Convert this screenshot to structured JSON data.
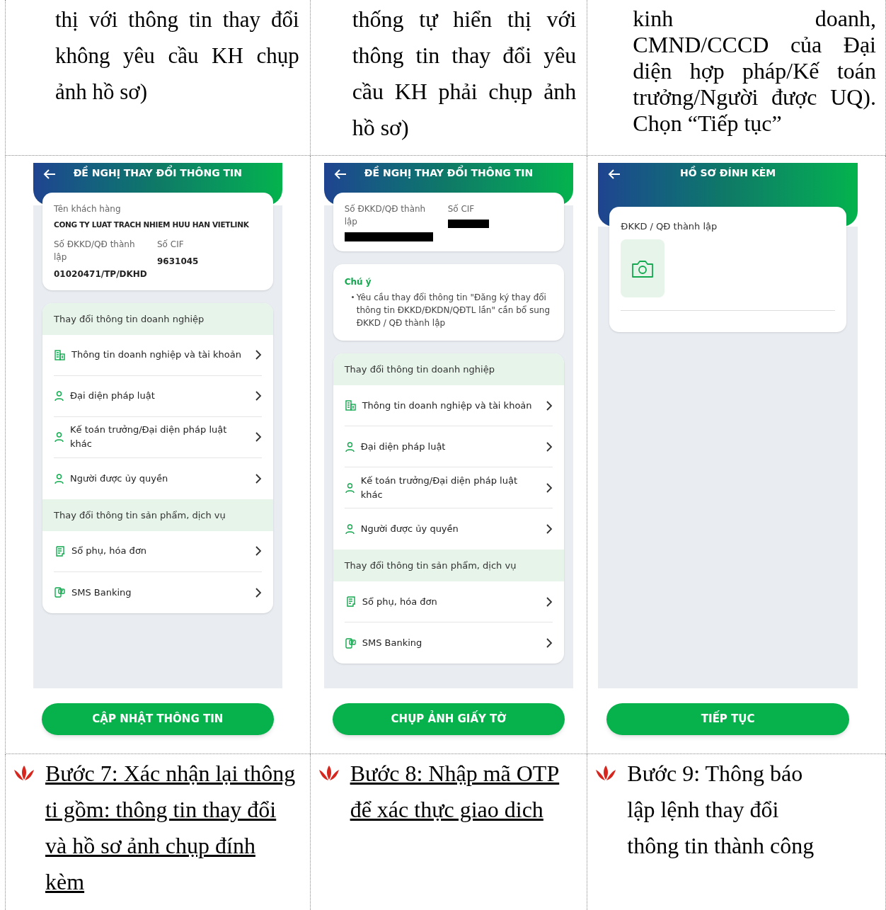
{
  "intro_row": [
    {
      "text": "thị với thông tin thay đổi không yêu cầu KH chụp ảnh hồ sơ)"
    },
    {
      "text": "thống tự hiển thị với thông tin thay đổi yêu cầu KH phải chụp ảnh hồ sơ)"
    },
    {
      "text": "kinh doanh, CMND/CCCD của Đại diện hợp pháp/Kế toán trưởng/Người được UQ). Chọn “Tiếp tục”"
    }
  ],
  "screens": [
    {
      "kind": "form",
      "title": "ĐỀ NGHỊ THAY ĐỔI THÔNG TIN",
      "info": {
        "customer_label": "Tên khách hàng",
        "customer_name": "CONG TY LUAT TRACH NHIEM HUU HAN VIETLINK",
        "fields": [
          {
            "label": "Số ĐKKD/QĐ thành lập",
            "value": "01020471/TP/DKHD",
            "redacted": false
          },
          {
            "label": "Số CIF",
            "value": "9631045",
            "redacted": false
          }
        ]
      },
      "sections": [
        {
          "title": "Thay đổi thông tin doanh nghiệp",
          "items": [
            {
              "kind": "building",
              "label": "Thông tin doanh nghiệp và tài khoản"
            },
            {
              "kind": "person",
              "label": "Đại diện pháp luật"
            },
            {
              "kind": "person",
              "label": "Kế toán trưởng/Đại diện pháp luật khác"
            },
            {
              "kind": "person",
              "label": "Người được ủy quyền"
            }
          ]
        },
        {
          "title": "Thay đổi thông tin sản phẩm, dịch vụ",
          "items": [
            {
              "kind": "receipt",
              "label": "Sổ phụ, hóa đơn"
            },
            {
              "kind": "phone",
              "label": "SMS Banking"
            }
          ]
        }
      ],
      "button": "CẬP NHẬT THÔNG TIN"
    },
    {
      "kind": "form",
      "title": "ĐỀ NGHỊ THAY ĐỔI THÔNG TIN",
      "info": {
        "fields": [
          {
            "label": "Số ĐKKD/QĐ thành lập",
            "redacted": true
          },
          {
            "label": "Số CIF",
            "redacted": true
          }
        ]
      },
      "notice": {
        "title": "Chú ý",
        "bullet": "Yêu cầu thay đổi thông tin \"Đăng ký thay đổi thông tin ĐKKD/ĐKDN/QĐTL lần\" cần bổ sung ĐKKD / QĐ thành lập"
      },
      "sections": [
        {
          "title": "Thay đổi thông tin doanh nghiệp",
          "items": [
            {
              "kind": "building",
              "label": "Thông tin doanh nghiệp và tài khoản"
            },
            {
              "kind": "person",
              "label": "Đại diện pháp luật"
            },
            {
              "kind": "person",
              "label": "Kế toán trưởng/Đại diện pháp luật khác"
            },
            {
              "kind": "person",
              "label": "Người được ủy quyền"
            }
          ]
        },
        {
          "title": "Thay đổi thông tin sản phẩm, dịch vụ",
          "items": [
            {
              "kind": "receipt",
              "label": "Sổ phụ, hóa đơn"
            },
            {
              "kind": "phone",
              "label": "SMS Banking"
            }
          ]
        }
      ],
      "button": "CHỤP ẢNH GIẤY TỜ"
    },
    {
      "kind": "attachments",
      "title": "HỒ SƠ ĐÍNH KÈM",
      "attachment_label": "ĐKKD / QĐ thành lập",
      "button": "TIẾP TỤC"
    }
  ],
  "steps": [
    {
      "text": "Bước 7: Xác nhận lại thông ti gồm: thông tin thay đổi và hồ sơ ảnh chụp đính kèm",
      "underlined": true
    },
    {
      "text": "Bước 8: Nhập mã OTP để xác thực giao dich",
      "underlined": true
    },
    {
      "text": "Bước 9: Thông báo lập lệnh thay đổi thông tin thành công",
      "underlined": false
    }
  ]
}
